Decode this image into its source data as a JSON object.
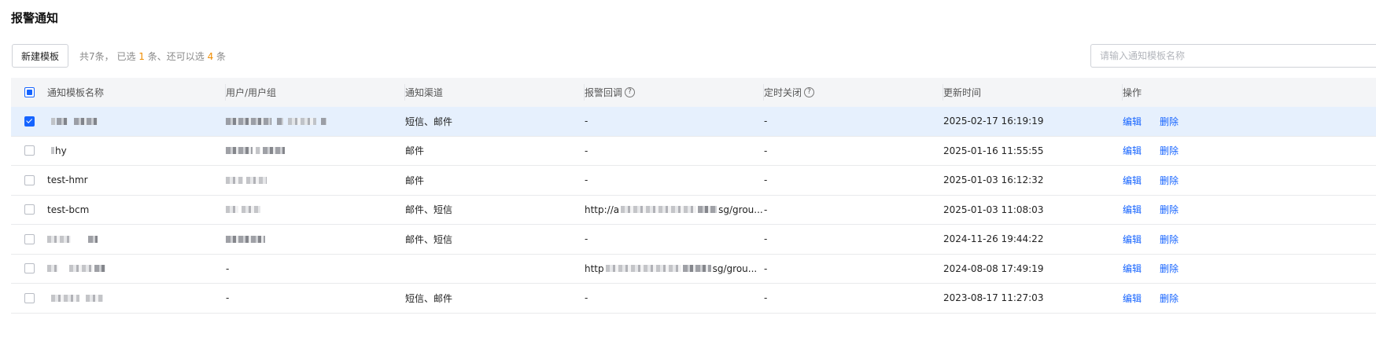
{
  "page": {
    "title": "报警通知"
  },
  "toolbar": {
    "new_button": "新建模板",
    "selection": {
      "prefix": "共7条， 已选 ",
      "selected": "1",
      "middle": " 条、还可以选 ",
      "remaining": "4",
      "suffix": " 条"
    },
    "search_placeholder": "请输入通知模板名称"
  },
  "table": {
    "headers": [
      "通知模板名称",
      "用户/用户组",
      "通知渠道",
      "报警回调",
      "定时关闭",
      "更新时间",
      "操作"
    ],
    "help_symbol": "?",
    "actions": {
      "edit": "编辑",
      "delete": "删除"
    },
    "rows": [
      {
        "checked": true,
        "name": "",
        "users": "",
        "channel": "短信、邮件",
        "callback_prefix": "",
        "callback_suffix": "-",
        "close": "-",
        "updated": "2025-02-17 16:19:19"
      },
      {
        "checked": false,
        "name": "hy",
        "users": "",
        "channel": "邮件",
        "callback_prefix": "",
        "callback_suffix": "-",
        "close": "-",
        "updated": "2025-01-16 11:55:55"
      },
      {
        "checked": false,
        "name": "test-hmr",
        "users": "",
        "channel": "邮件",
        "callback_prefix": "",
        "callback_suffix": "-",
        "close": "-",
        "updated": "2025-01-03 16:12:32"
      },
      {
        "checked": false,
        "name": "test-bcm",
        "users": "",
        "channel": "邮件、短信",
        "callback_prefix": "http://a",
        "callback_suffix": "sg/grou...",
        "close": "-",
        "updated": "2025-01-03 11:08:03"
      },
      {
        "checked": false,
        "name": "",
        "users": "",
        "channel": "邮件、短信",
        "callback_prefix": "",
        "callback_suffix": "-",
        "close": "-",
        "updated": "2024-11-26 19:44:22"
      },
      {
        "checked": false,
        "name": "",
        "users": "-",
        "channel": "",
        "callback_prefix": "http",
        "callback_suffix": "sg/grou...",
        "close": "-",
        "updated": "2024-08-08 17:49:19"
      },
      {
        "checked": false,
        "name": "",
        "users": "-",
        "channel": "短信、邮件",
        "callback_prefix": "",
        "callback_suffix": "-",
        "close": "-",
        "updated": "2023-08-17 11:27:03"
      }
    ]
  }
}
